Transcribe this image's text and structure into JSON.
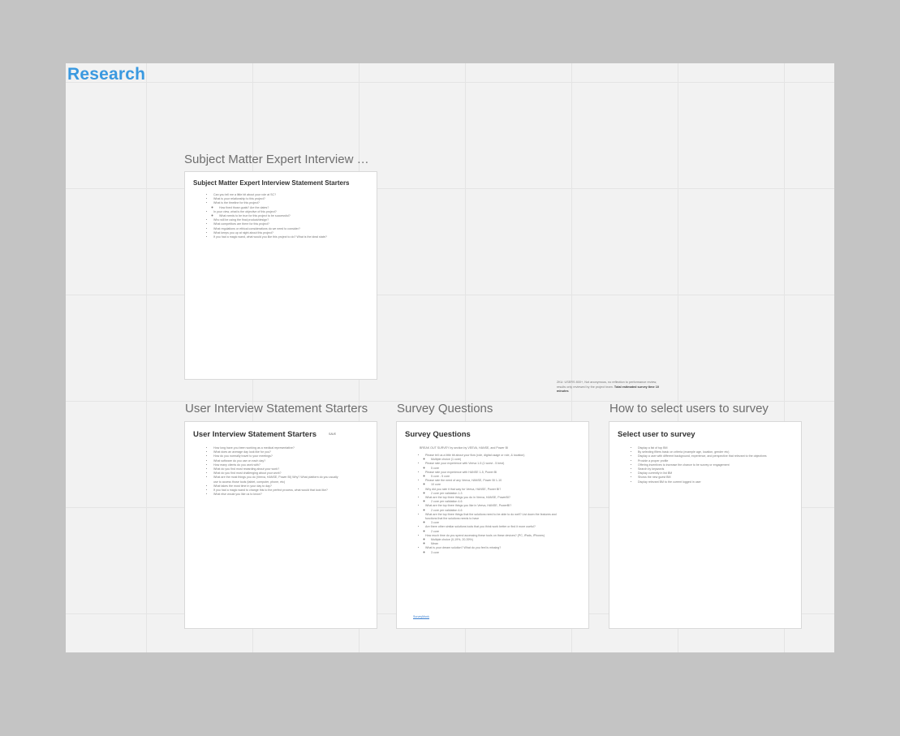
{
  "board": {
    "title": "Research"
  },
  "sme": {
    "label": "Subject Matter Expert Interview St...",
    "title": "Subject Matter Expert Interview Statement Starters",
    "items": [
      {
        "text": "Can you tell me a little bit about your role at SC?"
      },
      {
        "text": "What is your relationship to this project?"
      },
      {
        "text": "What is the timeline for this project?",
        "sub": [
          "How fixed those goals? Are the dates?"
        ]
      },
      {
        "text": "In your view, what is the objective of this project?",
        "sub": [
          "What needs to be true for this project to be successful?"
        ]
      },
      {
        "text": "Who will be using the final product/design?"
      },
      {
        "text": "What competitors are there for this project?"
      },
      {
        "text": "What regulations or ethical considerations do we need to consider?"
      },
      {
        "text": "What keeps you up at night about this project?"
      },
      {
        "text": "If you had a magic wand, what would you like this project to do? What is the ideal state?"
      }
    ]
  },
  "user_interview": {
    "label": "User Interview Statement Starters",
    "title": "User Interview Statement Starters",
    "tag": "SAVE",
    "items": [
      {
        "text": "How long have you been working as a medical representative?"
      },
      {
        "text": "What does an average day look like for you?"
      },
      {
        "text": "How do you normally travel to your meetings?"
      },
      {
        "text": "What software do you use on each day?"
      },
      {
        "text": "How many clients do you work with?"
      },
      {
        "text": "What do you find most rewarding about your work?"
      },
      {
        "text": "What do you find most challenging about your work?"
      },
      {
        "text": "What are the most things you do (Veeva, HANSE, Power BI) Why? What platform do you usually use to access those tools (tablet, computer, phone, etc)"
      },
      {
        "text": "What takes the most time in your day to day?"
      },
      {
        "text": "If you had a magic wand to change this to the perfect process, what would that look like?"
      },
      {
        "text": "What else would you like us to know?"
      }
    ]
  },
  "survey": {
    "label": "Survey Questions",
    "title": "Survey Questions",
    "intro": "BREAK OUT SURVEY by section by VEEVA, HANSE, and Power BI",
    "items": [
      {
        "text": "Please tell us a little bit about your flow (role, digital usage or role, & location)",
        "sub": [
          "Multiple choice (1 core)"
        ]
      },
      {
        "text": "Please rate your experience with Veeva 1-5 (1 worst - 5 best)",
        "sub": [
          "5 core"
        ]
      },
      {
        "text": "Please rate your experience with HANSE 1-5, Power BI",
        "sub": [
          "5 core - 5 core"
        ]
      },
      {
        "text": "Please rate the need of any Veeva, HANSE, Power BI 1-10",
        "sub": [
          "10 core"
        ]
      },
      {
        "text": "Why did you rate it that way for Veeva, HANSE, Power BI?",
        "sub": [
          "2 core per validation 1-3"
        ]
      },
      {
        "text": "What are the top three things you do in Veeva, HANSE, PowerBI?",
        "sub": [
          "2 core per validation 4-6"
        ]
      },
      {
        "text": "What are the top three things you like in Veeva, HANSE, PowerBI?",
        "sub": [
          "2 core per validation 4-6"
        ]
      },
      {
        "text": "What are the top three things that the solutions need to be able to do well? List down the features and functions that the solutions needs to have",
        "sub": [
          "3 core"
        ]
      },
      {
        "text": "Are there other similar solutions tools that you think work better or find it more useful?",
        "sub": [
          "2 core"
        ]
      },
      {
        "text": "How much time do you spend accessing these tools on these devices? (PC, iPads, iPhones)",
        "sub": [
          "Multiple choice (0-19%, 20-39%)",
          "Mean"
        ]
      },
      {
        "text": "What is your dream solution? What do you feel is missing?",
        "sub": [
          "3 core"
        ]
      }
    ],
    "link": "SurveyMonk"
  },
  "select_users": {
    "label": "How to select users to survey",
    "title": "Select user to survey",
    "items": [
      {
        "text": "Display a list of top BM"
      },
      {
        "text": "By selecting filters basic on criteria (example age, location, gender etc)"
      },
      {
        "text": "Display a user with different background, experience, and perspective that relevant to the objectives"
      },
      {
        "text": "Provide a proper profile"
      },
      {
        "text": "Offering incentives to increase the chance to be survey or engagement"
      },
      {
        "text": "Search by keywords"
      },
      {
        "text": "Display currently in list BM"
      },
      {
        "text": "Shows the new guest BM"
      },
      {
        "text": "Display relevant BM to the current logged in user"
      }
    ]
  },
  "note": {
    "text": "2KU: USERS 800+, Not anonymous, no reflection to performance review, results only reviewed by the project team.",
    "bold": "Total estimated survey time 10 minutes"
  }
}
